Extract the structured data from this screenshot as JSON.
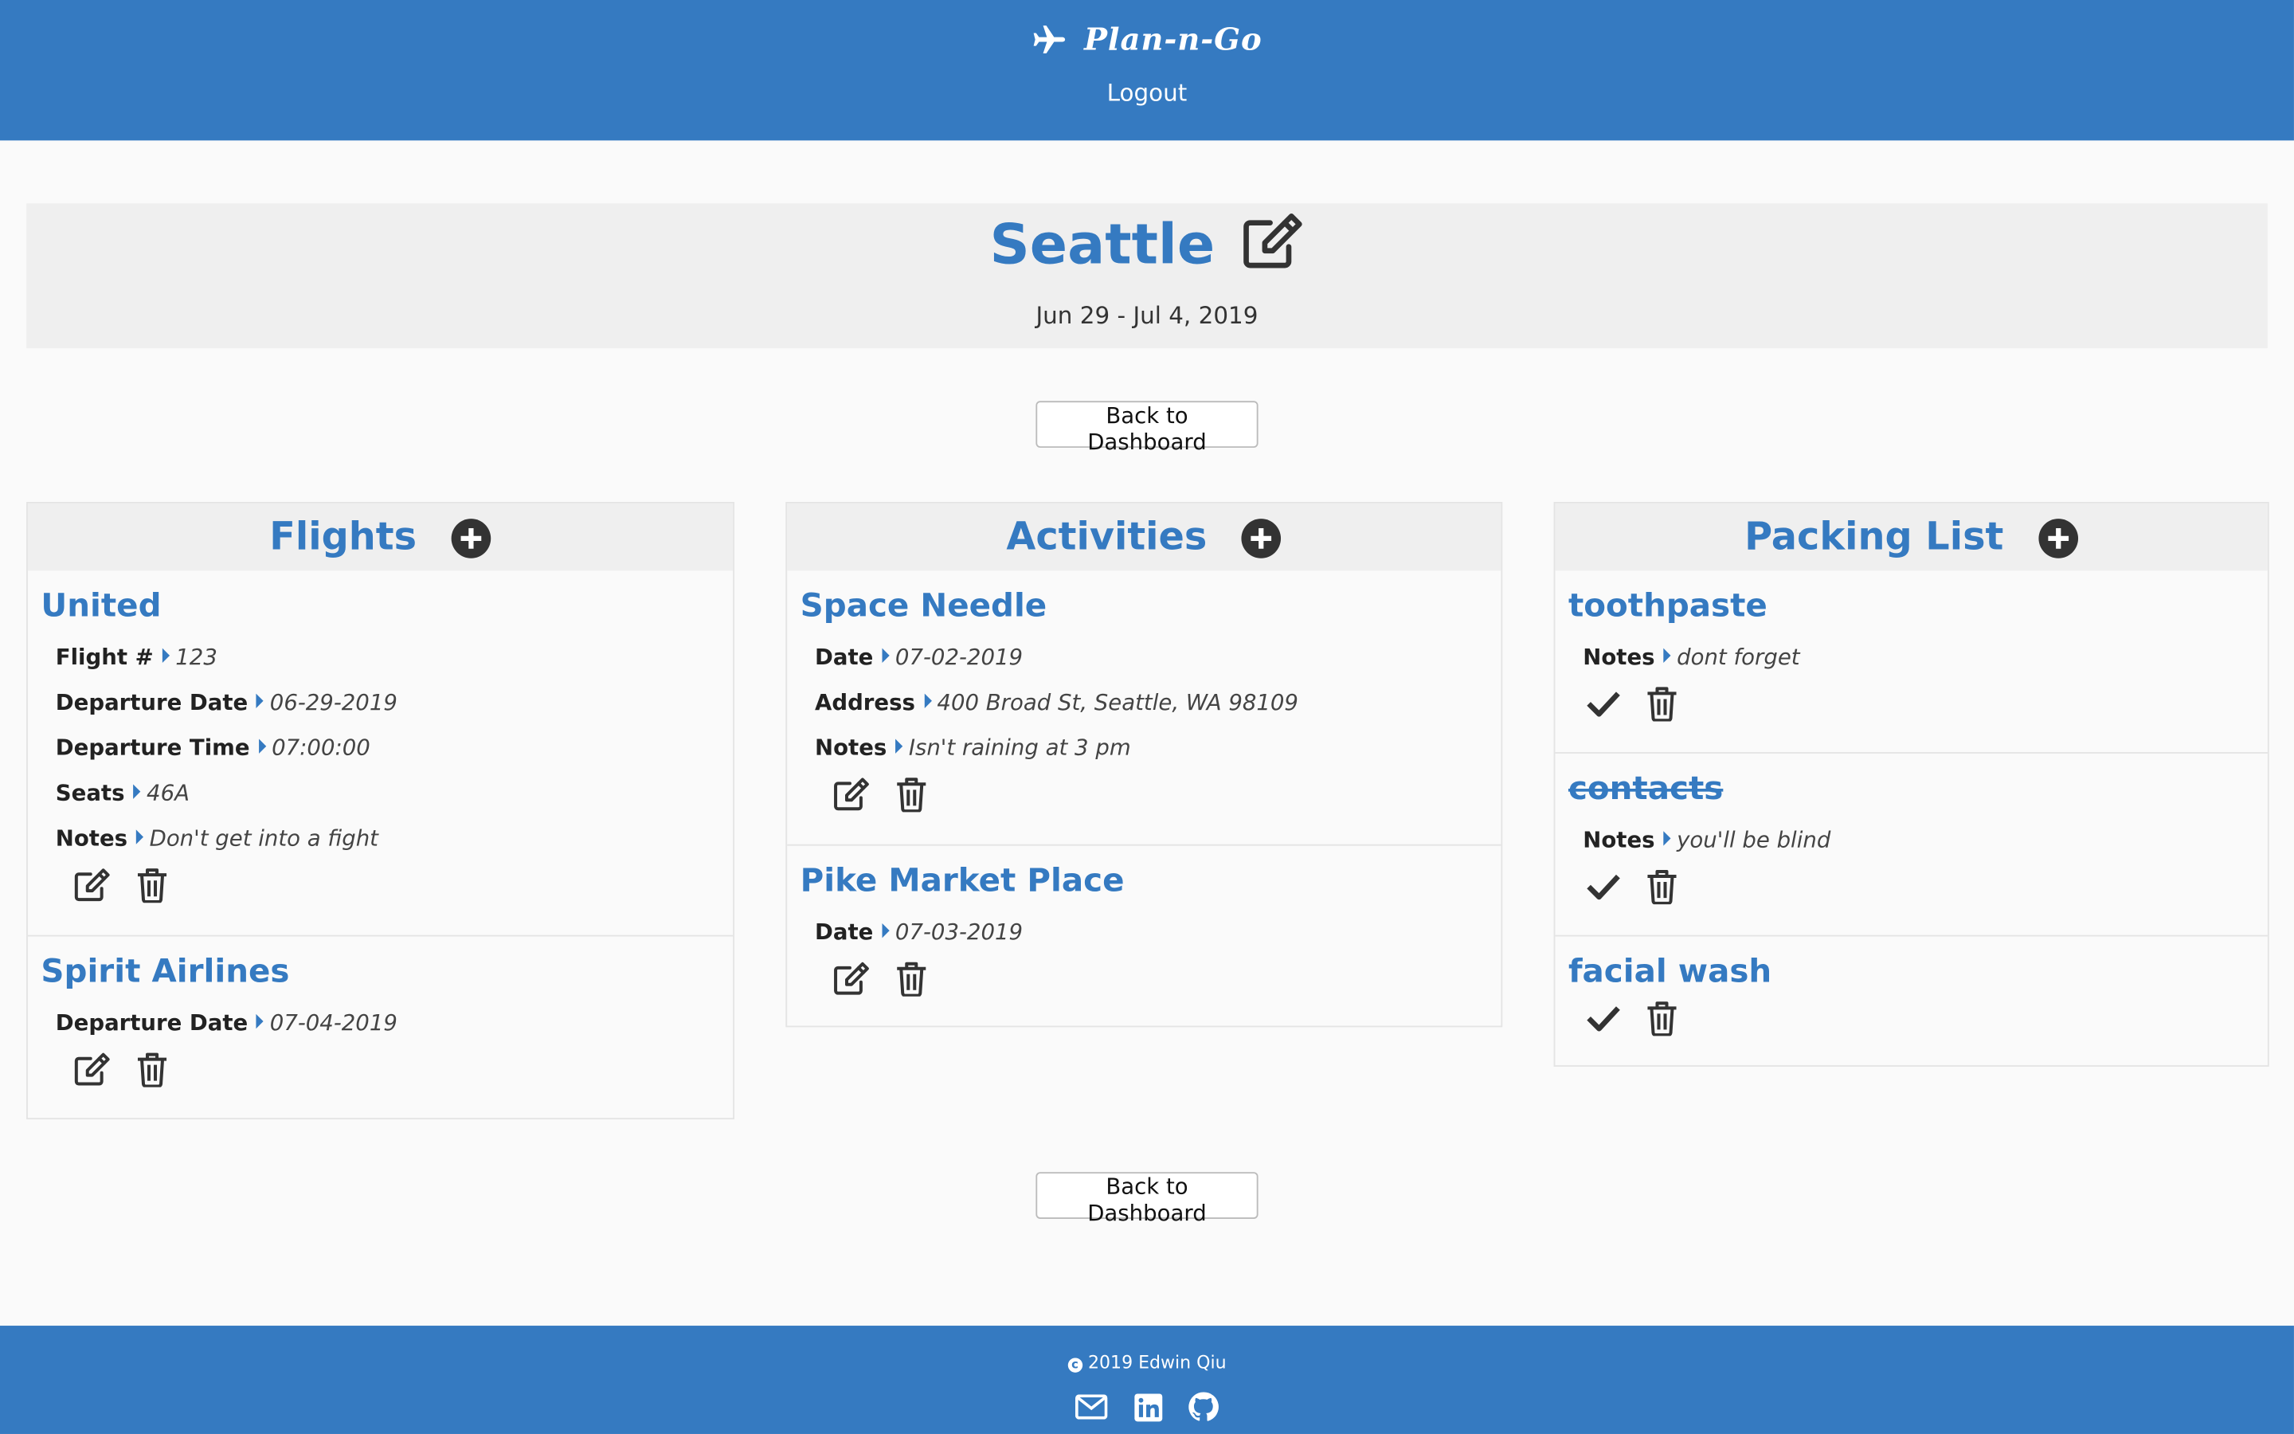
{
  "header": {
    "brand": "Plan-n-Go",
    "logout_label": "Logout"
  },
  "trip": {
    "name": "Seattle",
    "dates": "Jun 29 - Jul 4, 2019"
  },
  "buttons": {
    "back_label": "Back to Dashboard"
  },
  "flights": {
    "title": "Flights",
    "items": [
      {
        "name": "United",
        "fields": [
          {
            "label": "Flight #",
            "value": "123"
          },
          {
            "label": "Departure Date",
            "value": "06-29-2019"
          },
          {
            "label": "Departure Time",
            "value": "07:00:00"
          },
          {
            "label": "Seats",
            "value": "46A"
          },
          {
            "label": "Notes",
            "value": "Don't get into a fight"
          }
        ]
      },
      {
        "name": "Spirit Airlines",
        "fields": [
          {
            "label": "Departure Date",
            "value": "07-04-2019"
          }
        ]
      }
    ]
  },
  "activities": {
    "title": "Activities",
    "items": [
      {
        "name": "Space Needle",
        "fields": [
          {
            "label": "Date",
            "value": "07-02-2019"
          },
          {
            "label": "Address",
            "value": "400 Broad St, Seattle, WA 98109"
          },
          {
            "label": "Notes",
            "value": "Isn't raining at 3 pm"
          }
        ]
      },
      {
        "name": "Pike Market Place",
        "fields": [
          {
            "label": "Date",
            "value": "07-03-2019"
          }
        ]
      }
    ]
  },
  "packing": {
    "title": "Packing List",
    "items": [
      {
        "name": "toothpaste",
        "packed": false,
        "fields": [
          {
            "label": "Notes",
            "value": "dont forget"
          }
        ]
      },
      {
        "name": "contacts",
        "packed": true,
        "fields": [
          {
            "label": "Notes",
            "value": "you'll be blind"
          }
        ]
      },
      {
        "name": "facial wash",
        "packed": false,
        "fields": []
      }
    ]
  },
  "footer": {
    "copyright": "2019 Edwin Qiu",
    "icons": [
      "envelope-icon",
      "linkedin-icon",
      "github-icon"
    ]
  },
  "colors": {
    "primary": "#357ac1",
    "panel_header": "#efefef",
    "background": "#fafafa"
  }
}
